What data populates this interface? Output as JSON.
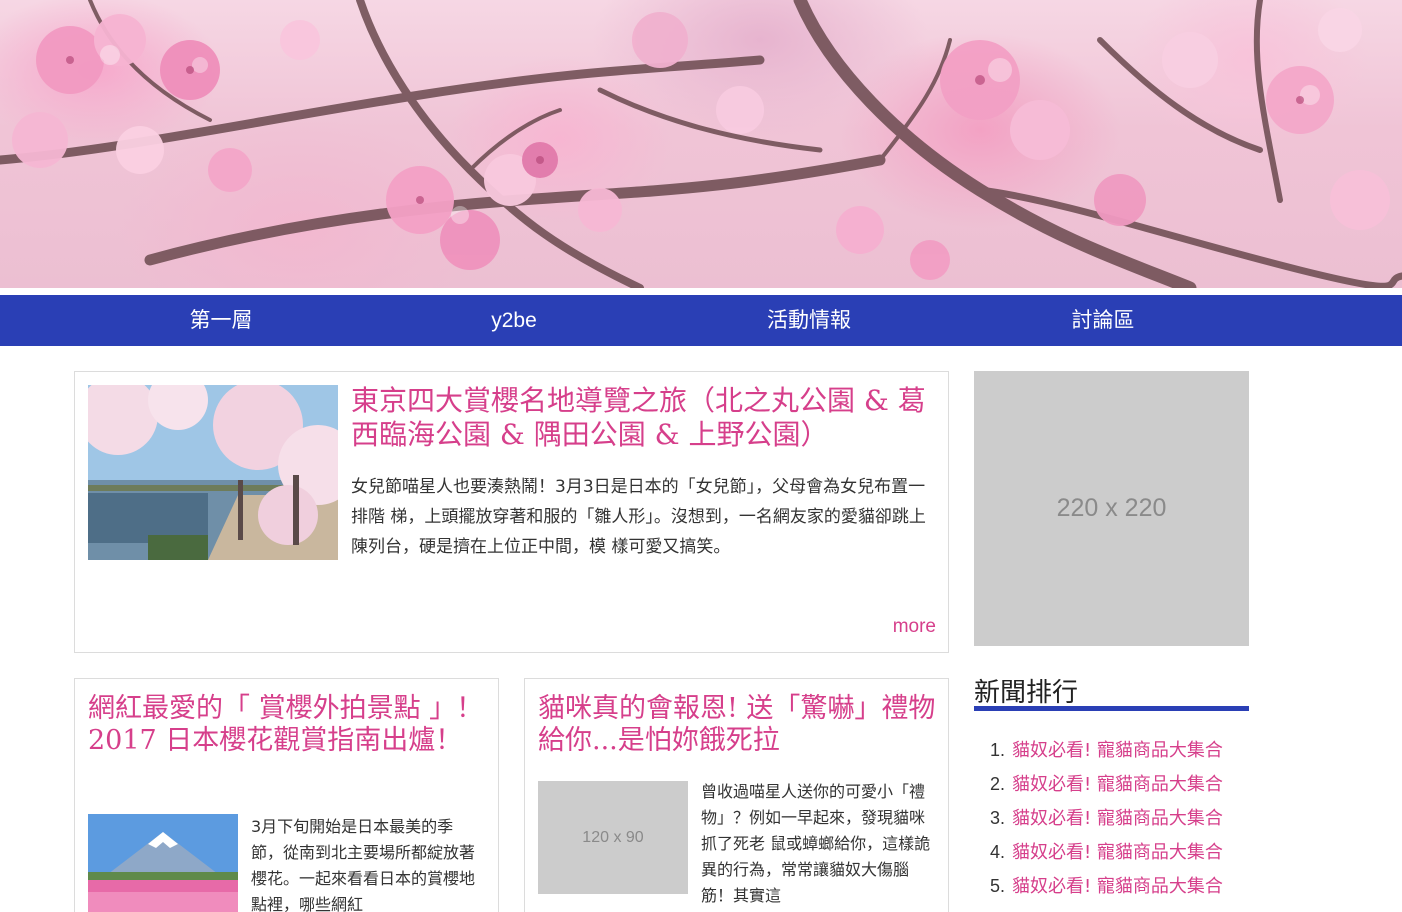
{
  "colors": {
    "nav_bg": "#2a3fb5",
    "accent_pink": "#d63f8b",
    "placeholder_gray": "#cccccc",
    "border": "#dcdcdc"
  },
  "hero": {
    "icon": "cherry-blossom-banner-image"
  },
  "nav": {
    "items": [
      {
        "label": "第一層"
      },
      {
        "label": "y2be"
      },
      {
        "label": "活動情報"
      },
      {
        "label": "討論區"
      }
    ]
  },
  "featured": {
    "title": "東京四大賞櫻名地導覽之旅（北之丸公園 & 葛西臨海公園 & 隅田公園 & 上野公園）",
    "body": "女兒節喵星人也要湊熱鬧！3月3日是日本的「女兒節」，父母會為女兒布置一排階 梯，上頭擺放穿著和服的「雛人形」。沒想到，一名網友家的愛貓卻跳上陳列台，硬是擠在上位正中間，模 樣可愛又搞笑。",
    "more": "more",
    "image_icon": "cherry-blossom-park-photo"
  },
  "sidebar": {
    "ad_label": "220 x 220",
    "heading": "新聞排行",
    "ranking": [
      {
        "num": "1.",
        "label": "貓奴必看! 寵貓商品大集合"
      },
      {
        "num": "2.",
        "label": "貓奴必看! 寵貓商品大集合"
      },
      {
        "num": "3.",
        "label": "貓奴必看! 寵貓商品大集合"
      },
      {
        "num": "4.",
        "label": "貓奴必看! 寵貓商品大集合"
      },
      {
        "num": "5.",
        "label": "貓奴必看! 寵貓商品大集合"
      }
    ]
  },
  "card2": {
    "title": "網紅最愛的「 賞櫻外拍景點 」！ 2017 日本櫻花觀賞指南出爐！",
    "body": "3月下旬開始是日本最美的季節，從南到北主要場所都綻放著櫻花。一起來看看日本的賞櫻地點裡，哪些網紅",
    "image_icon": "mount-fuji-flower-field-photo"
  },
  "card3": {
    "title": "貓咪真的會報恩! 送「驚嚇」禮物給你...是怕妳餓死拉",
    "body": "曾收過喵星人送你的可愛小「禮物」？例如一早起來，發現貓咪抓了死老 鼠或蟑螂給你，這樣詭異的行為，常常讓貓奴大傷腦筋！其實這",
    "image_label": "120 x 90"
  }
}
